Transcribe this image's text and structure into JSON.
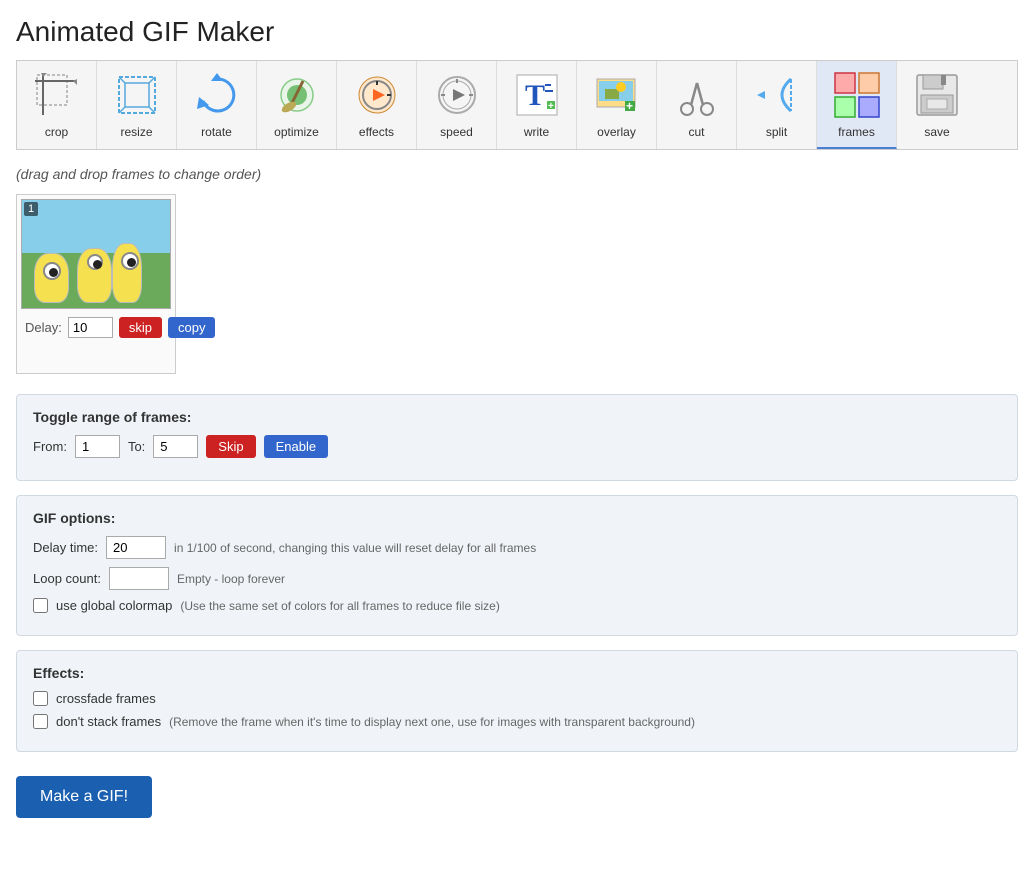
{
  "page": {
    "title": "Animated GIF Maker"
  },
  "toolbar": {
    "items": [
      {
        "id": "crop",
        "label": "crop",
        "icon": "crop-icon",
        "active": false
      },
      {
        "id": "resize",
        "label": "resize",
        "icon": "resize-icon",
        "active": false
      },
      {
        "id": "rotate",
        "label": "rotate",
        "icon": "rotate-icon",
        "active": false
      },
      {
        "id": "optimize",
        "label": "optimize",
        "icon": "optimize-icon",
        "active": false
      },
      {
        "id": "effects",
        "label": "effects",
        "icon": "effects-icon",
        "active": false
      },
      {
        "id": "speed",
        "label": "speed",
        "icon": "speed-icon",
        "active": false
      },
      {
        "id": "write",
        "label": "write",
        "icon": "write-icon",
        "active": false
      },
      {
        "id": "overlay",
        "label": "overlay",
        "icon": "overlay-icon",
        "active": false
      },
      {
        "id": "cut",
        "label": "cut",
        "icon": "cut-icon",
        "active": false
      },
      {
        "id": "split",
        "label": "split",
        "icon": "split-icon",
        "active": false
      },
      {
        "id": "frames",
        "label": "frames",
        "icon": "frames-icon",
        "active": true
      },
      {
        "id": "save",
        "label": "save",
        "icon": "save-icon",
        "active": false
      }
    ]
  },
  "drag_hint": "(drag and drop frames to change order)",
  "frames": [
    {
      "number": 1,
      "delay": "10",
      "skip_label": "skip",
      "copy_label": "copy"
    }
  ],
  "toggle_section": {
    "title": "Toggle range of frames:",
    "from_label": "From:",
    "from_value": "1",
    "to_label": "To:",
    "to_value": "5",
    "skip_label": "Skip",
    "enable_label": "Enable"
  },
  "gif_options": {
    "title": "GIF options:",
    "delay_label": "Delay time:",
    "delay_value": "20",
    "delay_hint": "in 1/100 of second, changing this value will reset delay for all frames",
    "loop_label": "Loop count:",
    "loop_value": "",
    "loop_hint": "Empty - loop forever",
    "colormap_label": "use global colormap",
    "colormap_hint": "Use the same set of colors for all frames to reduce file size",
    "colormap_checked": false
  },
  "effects_section": {
    "title": "Effects:",
    "crossfade_label": "crossfade frames",
    "crossfade_checked": false,
    "no_stack_label": "don't stack frames",
    "no_stack_hint": "(Remove the frame when it's time to display next one, use for images with transparent background)",
    "no_stack_checked": false
  },
  "make_gif_button": "Make a GIF!"
}
